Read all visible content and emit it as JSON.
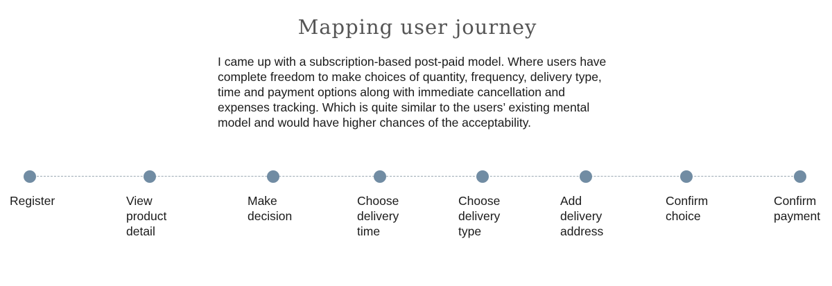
{
  "title": "Mapping user journey",
  "description": "I came up with a subscription-based post-paid model. Where users have complete freedom to make choices of quantity, frequency, delivery type, time and payment options along with immediate cancellation and expenses tracking. Which is quite similar to the users’ existing mental model and would have higher chances of the acceptability.",
  "description_lines": [
    "I came up with a subscription-based post-paid model. Where users have",
    "complete freedom to make choices of quantity, frequency, delivery type,",
    "time and payment options along with immediate cancellation and",
    "expenses tracking. Which is quite similar to the users’ existing mental",
    "model and would have higher chances of the acceptability."
  ],
  "colors": {
    "node": "#718ca3",
    "line": "#9aa7b2",
    "title": "#555555",
    "text": "#1a1a1a"
  },
  "steps": [
    {
      "id": "register",
      "lines": [
        "Register"
      ]
    },
    {
      "id": "view-product-detail",
      "lines": [
        "View",
        "product",
        "detail"
      ]
    },
    {
      "id": "make-decision",
      "lines": [
        "Make",
        "decision"
      ]
    },
    {
      "id": "choose-delivery-time",
      "lines": [
        "Choose",
        "delivery",
        "time"
      ]
    },
    {
      "id": "choose-delivery-type",
      "lines": [
        "Choose",
        "delivery",
        "type"
      ]
    },
    {
      "id": "add-delivery-address",
      "lines": [
        "Add",
        "delivery",
        "address"
      ]
    },
    {
      "id": "confirm-choice",
      "lines": [
        "Confirm",
        "choice"
      ]
    },
    {
      "id": "confirm-payment",
      "lines": [
        "Confirm",
        "payment"
      ]
    }
  ]
}
